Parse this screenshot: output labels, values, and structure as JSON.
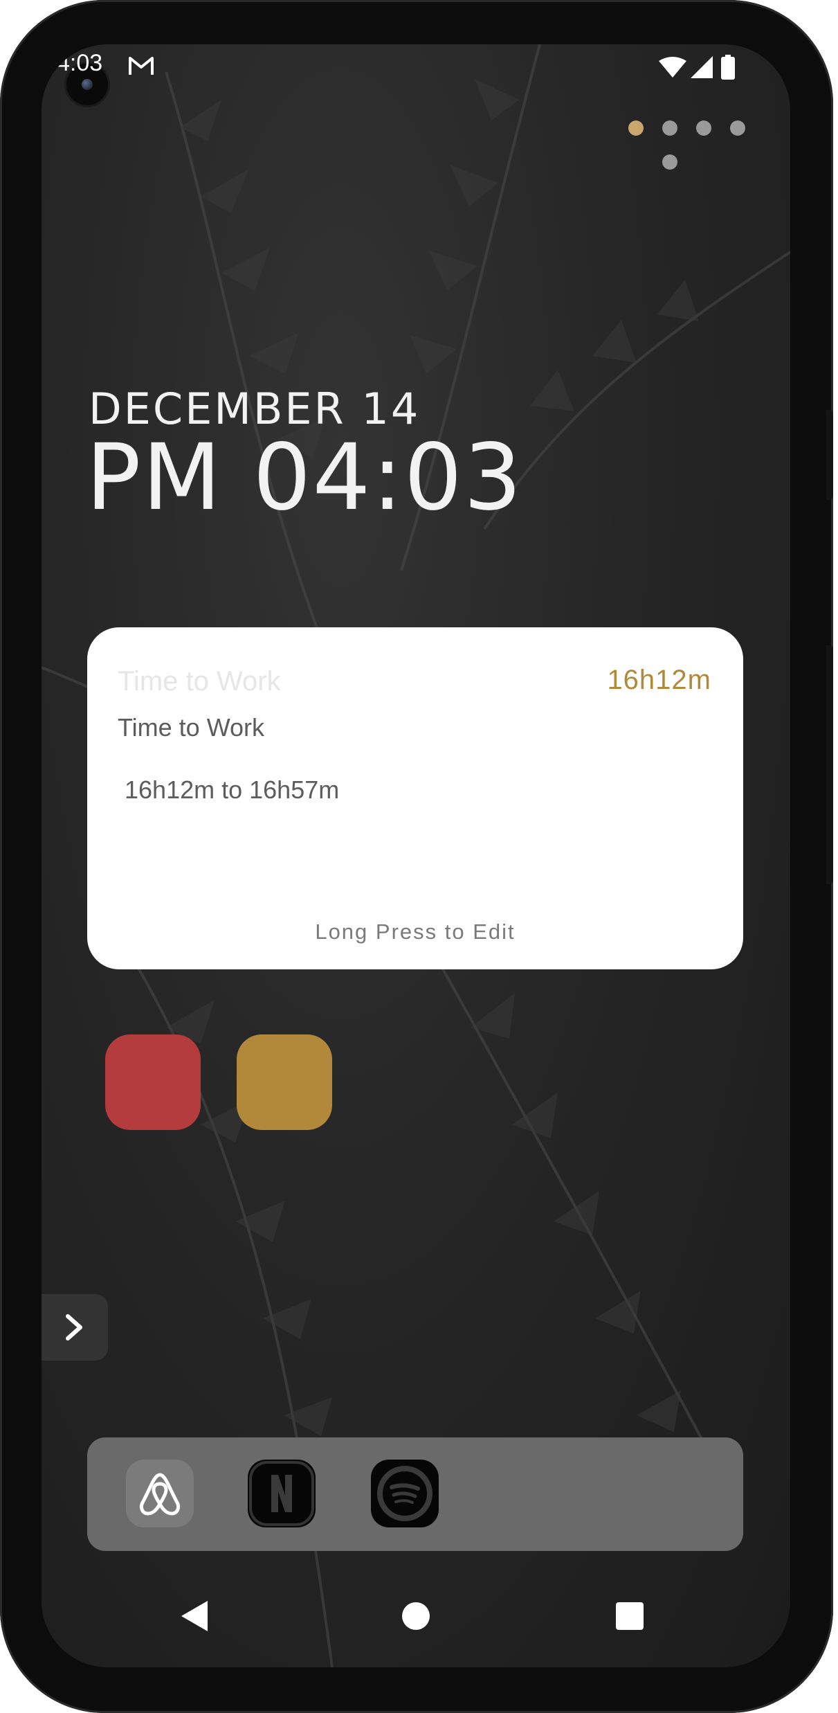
{
  "status_bar": {
    "time": "4:03",
    "icons": [
      "gmail-icon",
      "wifi-icon",
      "signal-icon",
      "battery-icon"
    ]
  },
  "page_indicator": {
    "pages": 5,
    "active": 0,
    "active_color": "#c9a66b",
    "inactive_color": "#9a9a9a"
  },
  "home": {
    "date": "DECEMBER 14",
    "clock": "PM 04:03"
  },
  "widget": {
    "ghost_title": "Time to Work",
    "duration": "16h12m",
    "title": "Time to Work",
    "range": "16h12m to 16h57m",
    "hint": "Long Press to Edit",
    "accent": "#b08a3a"
  },
  "shortcuts": [
    {
      "name": "red-shortcut",
      "color": "#b53c3c"
    },
    {
      "name": "gold-shortcut",
      "color": "#b2893a"
    }
  ],
  "drawer": {
    "icon": "chevron-right-icon"
  },
  "dock": {
    "apps": [
      {
        "name": "Airbnb",
        "icon": "airbnb-icon"
      },
      {
        "name": "Netflix",
        "icon": "netflix-icon",
        "glyph": "N"
      },
      {
        "name": "Spotify",
        "icon": "spotify-icon"
      }
    ]
  },
  "nav": {
    "buttons": [
      "back-icon",
      "home-icon",
      "recents-icon"
    ]
  }
}
